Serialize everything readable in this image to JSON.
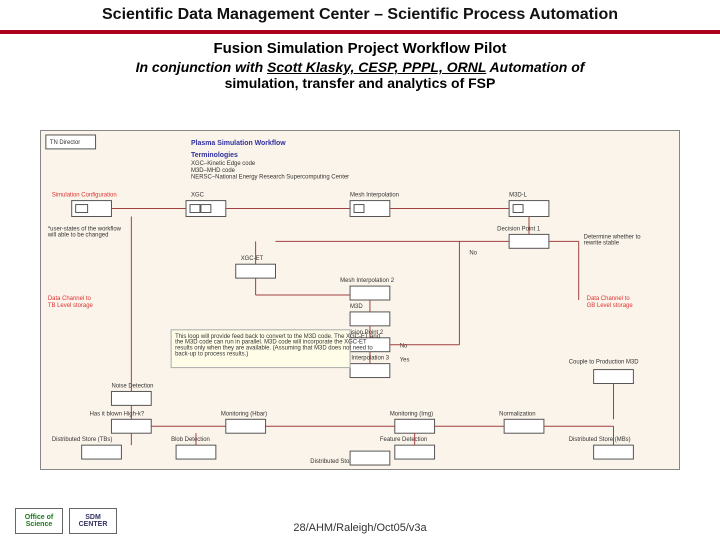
{
  "header": "Scientific Data Management Center – Scientific Process Automation",
  "sub1": "Fusion Simulation Project Workflow Pilot",
  "sub2_italic": "In conjunction with ",
  "sub2_underline": "Scott Klasky, CESP, PPPL, ORNL",
  "sub2_after": " Automation of",
  "sub3": "simulation, transfer and analytics of FSP",
  "diagram": {
    "title": "Plasma Simulation Workflow",
    "corner1": "TN Director",
    "terminologies": "Terminologies",
    "term1": "XGC–Kinetic Edge code",
    "term2": "M3D–MHD code",
    "term3": "NERSC–National Energy Research Supercomputing Center",
    "sim_config": "Simulation Configuration",
    "sim_note": "*user-states of the workflow will able to be changed",
    "xgc": "XGC",
    "mesh": "Mesh Interpolation",
    "m3dl": "M3D-L",
    "decision1": "Decision Point 1",
    "decision1_note": "Determine whether to rewrite stable",
    "no": "No",
    "yes": "Yes",
    "xgcet": "XGC-ET",
    "mesh2": "Mesh Interpolation 2",
    "m3d": "M3D",
    "decision2": "Decision Point 2",
    "mesh3": "Mesh Interpolation 3",
    "data_tb": "Data Channel to TB Level storage",
    "data_gb": "Data Channel to GB Level storage",
    "loop_note": "This loop will provide feed back to convert to the M3D code. The XGC-ET and the M3D code can run in parallel. M3D code will incorporate the XGC-ET results only when they are available. (Assuming that M3D does not need to back-up to process results.)",
    "noise": "Noise Detection",
    "couple": "Couple to Production M3D",
    "highk1": "Has it blown High-k?",
    "monhbar": "Monitoring (Hbar)",
    "monimg": "Monitoring (Img)",
    "normal": "Normalization",
    "dist_tb": "Distributed Store (TBs)",
    "blob": "Blob Detection",
    "feature": "Feature Detection",
    "dist_mb2": "Distributed Store (MBs)",
    "dist_mb": "Distributed Store (MBs)"
  },
  "footer": "28/AHM/Raleigh/Oct05/v3a",
  "logo1a": "Office of",
  "logo1b": "Science",
  "logo2a": "SDM",
  "logo2b": "CENTER"
}
